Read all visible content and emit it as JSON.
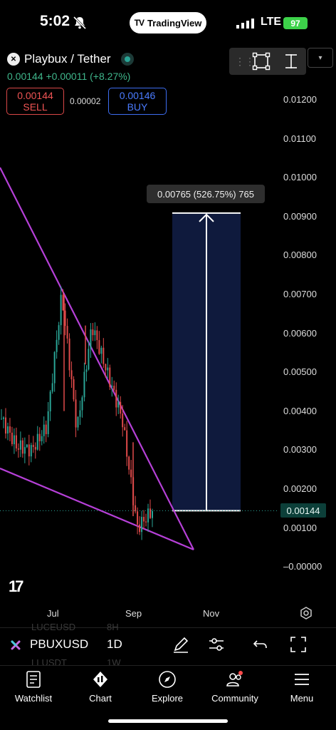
{
  "status_bar": {
    "time": "5:02",
    "network": "LTE",
    "battery": "97"
  },
  "app_pill": {
    "brand": "TradingView",
    "logo_text": "TV"
  },
  "symbol": {
    "title": "Playbux / Tether",
    "icon_text": "✕",
    "last": "0.00144",
    "change": "+0.00011",
    "change_pct": "(+8.27%)"
  },
  "quote": {
    "sell_price": "0.00144",
    "sell_label": "SELL",
    "spread": "0.00002",
    "buy_price": "0.00146",
    "buy_label": "BUY"
  },
  "measure": {
    "label": "0.00765 (526.75%) 765"
  },
  "last_price_badge": "0.00144",
  "chart_data": {
    "type": "candlestick",
    "symbol": "PBUXUSD",
    "interval": "1D",
    "y_ticks": [
      "0.01200",
      "0.01100",
      "0.01000",
      "0.00900",
      "0.00800",
      "0.00700",
      "0.00600",
      "0.00500",
      "0.00400",
      "0.00300",
      "0.00200",
      "0.00100",
      "–0.00000"
    ],
    "x_ticks": [
      "Jul",
      "Sep",
      "Nov"
    ],
    "last_price": 0.00144,
    "price_range": [
      -0.0005,
      0.0128
    ],
    "approx_series": [
      {
        "label": "start",
        "value": 0.0038
      },
      {
        "label": "early Jun",
        "value": 0.0031
      },
      {
        "label": "mid Jun",
        "value": 0.003
      },
      {
        "label": "late Jun",
        "value": 0.0036
      },
      {
        "label": "Jul spike high",
        "value": 0.007
      },
      {
        "label": "Jul",
        "value": 0.0035
      },
      {
        "label": "Aug high",
        "value": 0.0062
      },
      {
        "label": "Aug",
        "value": 0.005
      },
      {
        "label": "late Aug",
        "value": 0.0038
      },
      {
        "label": "Sep low",
        "value": 0.001
      },
      {
        "label": "Sep",
        "value": 0.00144
      }
    ],
    "measure_from": 0.00144,
    "measure_to": 0.00909,
    "measure_change": 0.00765,
    "measure_change_pct": 526.75,
    "measure_bars": 765
  },
  "watermark": "17",
  "ghost_rows": [
    {
      "sym": "LUCEUSD",
      "int": "8H"
    },
    {
      "sym": "LLUSDT",
      "int": "1W"
    }
  ],
  "bottom_bar": {
    "ticker": "PBUXUSD",
    "interval": "1D"
  },
  "nav": [
    {
      "label": "Watchlist",
      "icon": "watchlist-icon"
    },
    {
      "label": "Chart",
      "icon": "chart-icon"
    },
    {
      "label": "Explore",
      "icon": "compass-icon"
    },
    {
      "label": "Community",
      "icon": "community-icon"
    },
    {
      "label": "Menu",
      "icon": "menu-icon"
    }
  ],
  "colors": {
    "up": "#2aa596",
    "down": "#e04a4a",
    "wedge": "#b640d8",
    "measure_fill": "#0f1a3d",
    "accent": "#3dd24a"
  }
}
